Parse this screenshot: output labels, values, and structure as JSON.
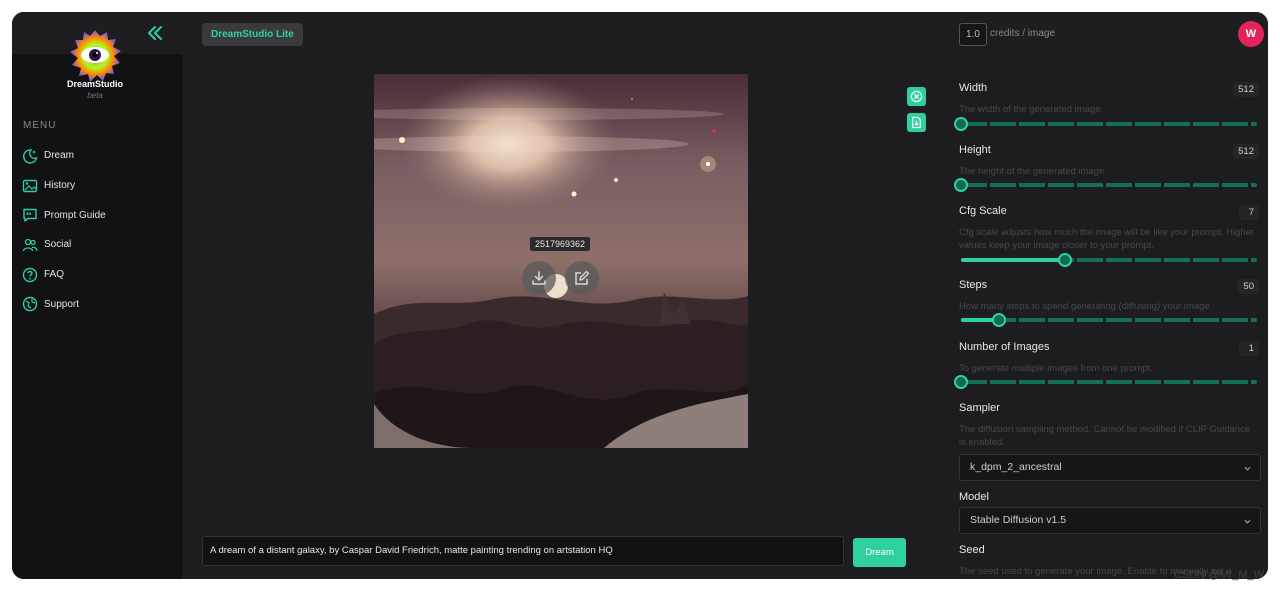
{
  "app": {
    "logo_text": "DreamStudio",
    "logo_sub": "beta",
    "header_tag": "DreamStudio Lite",
    "avatar_initial": "W",
    "accent_color": "#2fd0a0",
    "avatar_color": "#e3245a"
  },
  "credits": {
    "value": "1.0",
    "label": "credits / image"
  },
  "sidebar": {
    "menu_title": "MENU",
    "items": [
      {
        "label": "Dream",
        "icon": "moon-sparkle-icon"
      },
      {
        "label": "History",
        "icon": "image-gallery-icon"
      },
      {
        "label": "Prompt Guide",
        "icon": "quote-bubble-icon"
      },
      {
        "label": "Social",
        "icon": "people-icon"
      },
      {
        "label": "FAQ",
        "icon": "question-circle-icon"
      },
      {
        "label": "Support",
        "icon": "support-globe-icon"
      }
    ]
  },
  "image": {
    "seed": "2517969362",
    "description": "cosmic galaxy over clouds painting"
  },
  "prompt": {
    "text": "A dream of a distant galaxy, by Caspar David Friedrich, matte painting trending on artstation HQ",
    "button": "Dream"
  },
  "settings": {
    "width": {
      "label": "Width",
      "value": "512",
      "desc": "The width of the generated image.",
      "level": 0.0
    },
    "height": {
      "label": "Height",
      "value": "512",
      "desc": "The height of the generated image.",
      "level": 0.0
    },
    "cfg": {
      "label": "Cfg Scale",
      "value": "7",
      "desc": "Cfg scale adjusts how much the image will be like your prompt. Higher values keep your image closer to your prompt.",
      "level": 0.35
    },
    "steps": {
      "label": "Steps",
      "value": "50",
      "desc": "How many steps to spend generating (diffusing) your image.",
      "level": 0.13
    },
    "num_images": {
      "label": "Number of Images",
      "value": "1",
      "desc": "To generate multiple images from one prompt.",
      "level": 0.0
    },
    "sampler": {
      "label": "Sampler",
      "desc": "The diffusion sampling method. Cannot be modified if CLIP Guidance is enabled.",
      "selected": "k_dpm_2_ancestral"
    },
    "model": {
      "label": "Model",
      "selected": "Stable Diffusion v1.5"
    },
    "seed": {
      "label": "Seed",
      "desc": "The seed used to generate your image. Enable to manually set a seed."
    }
  },
  "watermark": "CSDN @Mr_M_W"
}
